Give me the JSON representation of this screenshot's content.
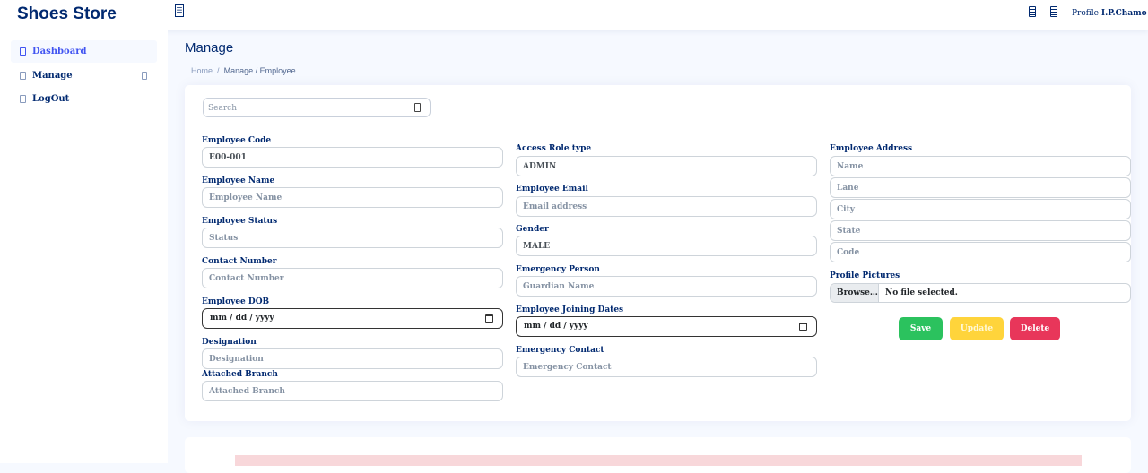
{
  "header": {
    "brand": "Shoes Store",
    "profile_label": "Profile",
    "user_name": "I.P.Chamo"
  },
  "sidebar": {
    "items": [
      {
        "label": "Dashboard"
      },
      {
        "label": "Manage"
      },
      {
        "label": "LogOut"
      }
    ]
  },
  "page": {
    "title": "Manage",
    "breadcrumb": {
      "home": "Home",
      "sep": "/",
      "current": "Manage / Employee"
    }
  },
  "search": {
    "placeholder": "Search"
  },
  "form": {
    "employee_code": {
      "label": "Employee Code",
      "value": "E00-001"
    },
    "employee_name": {
      "label": "Employee Name",
      "placeholder": "Employee Name"
    },
    "employee_status": {
      "label": "Employee Status",
      "placeholder": "Status"
    },
    "contact_number": {
      "label": "Contact Number",
      "placeholder": "Contact Number"
    },
    "employee_dob": {
      "label": "Employee DOB",
      "value": "mm / dd / yyyy"
    },
    "designation": {
      "label": "Designation",
      "placeholder": "Designation"
    },
    "attached_branch": {
      "label": "Attached Branch",
      "placeholder": "Attached Branch"
    },
    "access_role": {
      "label": "Access Role type",
      "value": "ADMIN"
    },
    "employee_email": {
      "label": "Employee Email",
      "placeholder": "Email address"
    },
    "gender": {
      "label": "Gender",
      "value": "MALE"
    },
    "emergency_person": {
      "label": "Emergency Person",
      "placeholder": "Guardian Name"
    },
    "joining_date": {
      "label": "Employee Joining Dates",
      "value": "mm / dd / yyyy"
    },
    "emergency_contact": {
      "label": "Emergency Contact",
      "placeholder": "Emergency Contact"
    },
    "address": {
      "label": "Employee Address",
      "name_placeholder": "Name",
      "lane_placeholder": "Lane",
      "city_placeholder": "City",
      "state_placeholder": "State",
      "code_placeholder": "Code"
    },
    "profile_pictures": {
      "label": "Profile Pictures",
      "browse": "Browse…",
      "status": "No file selected."
    }
  },
  "actions": {
    "save": "Save",
    "update": "Update",
    "delete": "Delete"
  },
  "colors": {
    "brand": "#012970",
    "accent": "#4154f1",
    "save": "#2bc25e",
    "update": "#ffd43b",
    "delete": "#e8365a"
  }
}
